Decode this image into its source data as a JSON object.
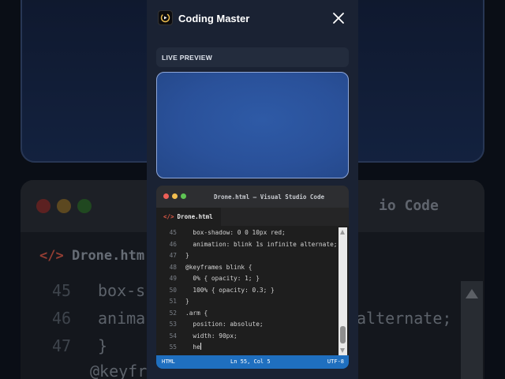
{
  "app": {
    "title": "Coding Master",
    "logo_icon": "coding-master-logo",
    "close_icon": "close-icon"
  },
  "live_preview": {
    "label": "LIVE PREVIEW",
    "background_color": "#2a519a",
    "border_color": "#8ea6d8"
  },
  "editor": {
    "window_title": "Drone.html — Visual Studio Code",
    "traffic_lights": [
      "#ed5f57",
      "#f3be4f",
      "#5fc454"
    ],
    "tab": {
      "icon": "</>",
      "label": "Drone.html"
    },
    "lines": [
      {
        "num": "45",
        "text": "  box-shadow: 0 0 10px red;"
      },
      {
        "num": "46",
        "text": "  animation: blink 1s infinite alternate;"
      },
      {
        "num": "47",
        "text": "}"
      },
      {
        "num": "48",
        "text": "@keyframes blink {"
      },
      {
        "num": "49",
        "text": "  0% { opacity: 1; }"
      },
      {
        "num": "50",
        "text": "  100% { opacity: 0.3; }"
      },
      {
        "num": "51",
        "text": "}"
      },
      {
        "num": "52",
        "text": ".arm {"
      },
      {
        "num": "53",
        "text": "  position: absolute;"
      },
      {
        "num": "54",
        "text": "  width: 90px;"
      },
      {
        "num": "55",
        "text": "  he"
      }
    ],
    "status": {
      "language": "HTML",
      "position": "Ln 55, Col 5",
      "encoding": "UTF-8",
      "color": "#1f6fbf"
    }
  },
  "background": {
    "title_fragment": "io Code",
    "tab_icon": "</>",
    "tab_fragment": "Drone.htm",
    "lines": [
      {
        "num": "45",
        "text": "box-s"
      },
      {
        "num": "46",
        "text": "anima",
        "tail": "alternate;"
      },
      {
        "num": "47",
        "text": "}"
      },
      {
        "num": "",
        "text": "@keyfra"
      }
    ]
  }
}
